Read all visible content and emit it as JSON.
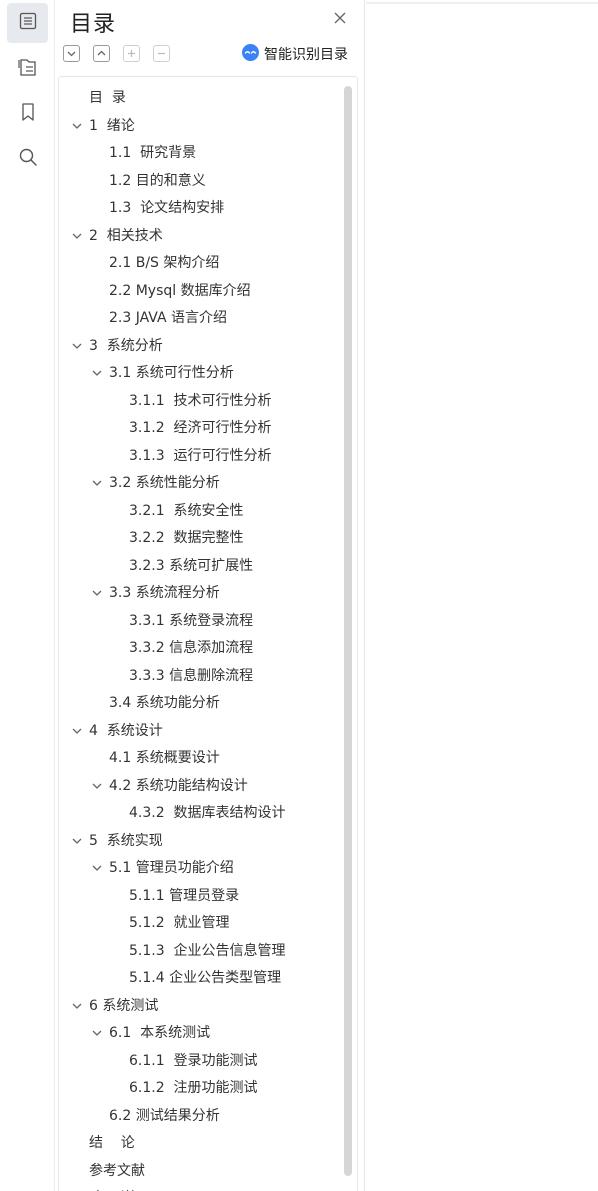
{
  "rail": {
    "items": [
      {
        "name": "outline-icon",
        "active": true
      },
      {
        "name": "thumbnail-icon",
        "active": false
      },
      {
        "name": "bookmark-icon",
        "active": false
      },
      {
        "name": "search-icon",
        "active": false
      }
    ]
  },
  "panel": {
    "title": "目录",
    "smart_label": "智能识别目录",
    "toolbar": [
      "collapse-all",
      "expand-all",
      "add-entry",
      "remove-entry"
    ]
  },
  "toc": [
    {
      "level": 0,
      "expanded": null,
      "text": "目  录"
    },
    {
      "level": 0,
      "expanded": true,
      "text": "1  绪论"
    },
    {
      "level": 1,
      "expanded": null,
      "text": "1.1  研究背景"
    },
    {
      "level": 1,
      "expanded": null,
      "text": "1.2 目的和意义"
    },
    {
      "level": 1,
      "expanded": null,
      "text": "1.3  论文结构安排"
    },
    {
      "level": 0,
      "expanded": true,
      "text": "2  相关技术"
    },
    {
      "level": 1,
      "expanded": null,
      "text": "2.1 B/S 架构介绍"
    },
    {
      "level": 1,
      "expanded": null,
      "text": "2.2 Mysql 数据库介绍"
    },
    {
      "level": 1,
      "expanded": null,
      "text": "2.3 JAVA 语言介绍"
    },
    {
      "level": 0,
      "expanded": true,
      "text": "3  系统分析"
    },
    {
      "level": 1,
      "expanded": true,
      "text": "3.1 系统可行性分析"
    },
    {
      "level": 2,
      "expanded": null,
      "text": "3.1.1  技术可行性分析"
    },
    {
      "level": 2,
      "expanded": null,
      "text": "3.1.2  经济可行性分析"
    },
    {
      "level": 2,
      "expanded": null,
      "text": "3.1.3  运行可行性分析"
    },
    {
      "level": 1,
      "expanded": true,
      "text": "3.2 系统性能分析"
    },
    {
      "level": 2,
      "expanded": null,
      "text": "3.2.1  系统安全性"
    },
    {
      "level": 2,
      "expanded": null,
      "text": "3.2.2  数据完整性"
    },
    {
      "level": 2,
      "expanded": null,
      "text": "3.2.3 系统可扩展性"
    },
    {
      "level": 1,
      "expanded": true,
      "text": "3.3 系统流程分析"
    },
    {
      "level": 2,
      "expanded": null,
      "text": "3.3.1 系统登录流程"
    },
    {
      "level": 2,
      "expanded": null,
      "text": "3.3.2 信息添加流程"
    },
    {
      "level": 2,
      "expanded": null,
      "text": "3.3.3 信息删除流程"
    },
    {
      "level": 1,
      "expanded": null,
      "text": "3.4 系统功能分析"
    },
    {
      "level": 0,
      "expanded": true,
      "text": "4  系统设计"
    },
    {
      "level": 1,
      "expanded": null,
      "text": "4.1 系统概要设计"
    },
    {
      "level": 1,
      "expanded": true,
      "text": "4.2 系统功能结构设计"
    },
    {
      "level": 2,
      "expanded": null,
      "text": "4.3.2  数据库表结构设计"
    },
    {
      "level": 0,
      "expanded": true,
      "text": "5  系统实现"
    },
    {
      "level": 1,
      "expanded": true,
      "text": "5.1 管理员功能介绍"
    },
    {
      "level": 2,
      "expanded": null,
      "text": "5.1.1 管理员登录"
    },
    {
      "level": 2,
      "expanded": null,
      "text": "5.1.2  就业管理"
    },
    {
      "level": 2,
      "expanded": null,
      "text": "5.1.3  企业公告信息管理"
    },
    {
      "level": 2,
      "expanded": null,
      "text": "5.1.4 企业公告类型管理"
    },
    {
      "level": 0,
      "expanded": true,
      "text": "6 系统测试"
    },
    {
      "level": 1,
      "expanded": true,
      "text": "6.1  本系统测试"
    },
    {
      "level": 2,
      "expanded": null,
      "text": "6.1.1  登录功能测试"
    },
    {
      "level": 2,
      "expanded": null,
      "text": "6.1.2  注册功能测试"
    },
    {
      "level": 1,
      "expanded": null,
      "text": "6.2 测试结果分析"
    },
    {
      "level": 0,
      "expanded": null,
      "text": "结    论"
    },
    {
      "level": 0,
      "expanded": null,
      "text": "参考文献"
    },
    {
      "level": 0,
      "expanded": null,
      "text": "致    谢"
    }
  ]
}
